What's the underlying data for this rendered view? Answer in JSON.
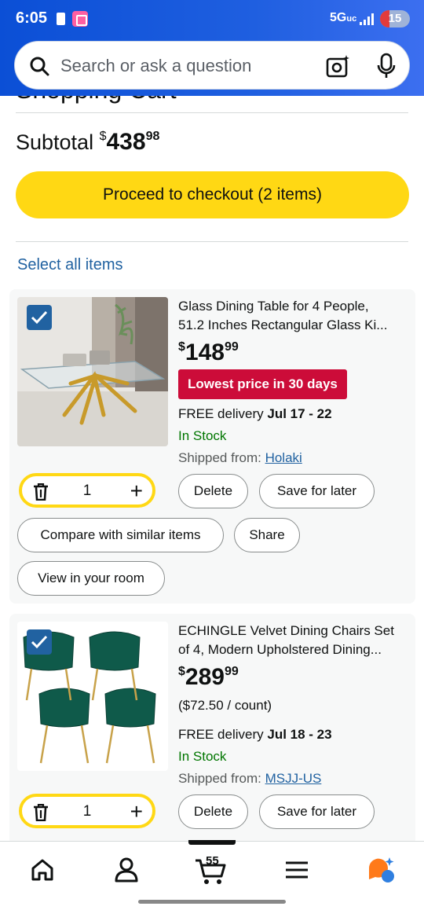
{
  "status_bar": {
    "time": "6:05",
    "network": "5G",
    "battery": "15"
  },
  "search": {
    "placeholder": "Search or ask a question"
  },
  "cart": {
    "title": "Shopping Cart",
    "subtotal_label": "Subtotal",
    "subtotal_currency": "$",
    "subtotal_whole": "438",
    "subtotal_fraction": "98",
    "checkout_label": "Proceed to checkout (2 items)",
    "select_all_label": "Select all items"
  },
  "items": [
    {
      "title_line1": "Glass Dining Table for 4 People,",
      "title_line2": "51.2 Inches Rectangular Glass Ki...",
      "price_currency": "$",
      "price_whole": "148",
      "price_fraction": "99",
      "deal_badge": "Lowest price in 30 days",
      "delivery_prefix": "FREE delivery ",
      "delivery_dates": "Jul 17 - 22",
      "stock": "In Stock",
      "shipped_prefix": "Shipped from: ",
      "seller": "Holaki",
      "quantity": "1",
      "delete_label": "Delete",
      "save_label": "Save for later",
      "compare_label": "Compare with similar items",
      "share_label": "Share",
      "view_room_label": "View in your room",
      "selected": true
    },
    {
      "title_line1": "ECHINGLE Velvet Dining Chairs Set",
      "title_line2": "of 4, Modern Upholstered Dining...",
      "price_currency": "$",
      "price_whole": "289",
      "price_fraction": "99",
      "unit_price": "($72.50 / count)",
      "delivery_prefix": "FREE delivery ",
      "delivery_dates": "Jul 18 - 23",
      "stock": "In Stock",
      "shipped_prefix": "Shipped from: ",
      "seller": "MSJJ-US",
      "quantity": "1",
      "delete_label": "Delete",
      "save_label": "Save for later",
      "selected": true
    }
  ],
  "bottom_nav": {
    "cart_count": "55",
    "items": [
      "home-icon",
      "account-icon",
      "cart-icon",
      "menu-icon",
      "rufus-icon"
    ]
  },
  "colors": {
    "header_blue": "#0b4fd6",
    "checkout_yellow": "#ffd814",
    "deal_red": "#cc0c39",
    "link_blue": "#2162a1",
    "stock_green": "#007600"
  }
}
